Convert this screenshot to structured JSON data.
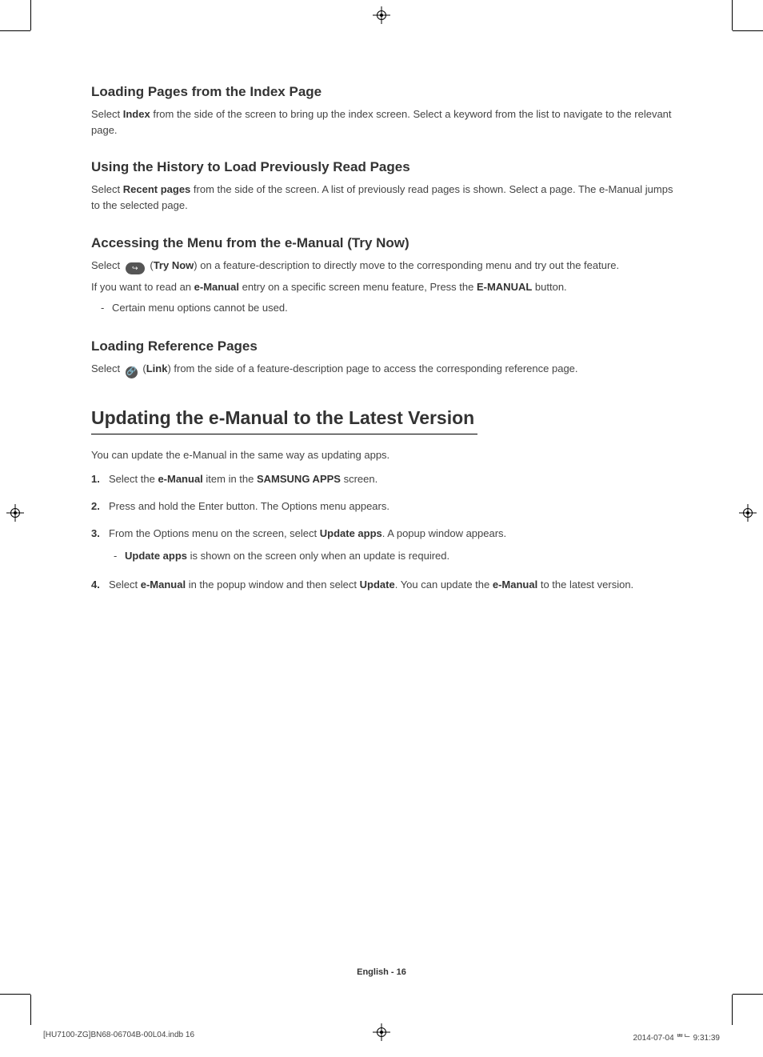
{
  "sections": {
    "index": {
      "heading": "Loading Pages from the Index Page",
      "body_pre": "Select ",
      "body_bold": "Index",
      "body_post": " from the side of the screen to bring up the index screen. Select a keyword from the list to navigate to the relevant page."
    },
    "history": {
      "heading": "Using the History to Load Previously Read Pages",
      "body_pre": "Select ",
      "body_bold": "Recent pages",
      "body_post": " from the side of the screen. A list of previously read pages is shown. Select a page. The e-Manual jumps to the selected page."
    },
    "trynow": {
      "heading": "Accessing the Menu from the e-Manual (Try Now)",
      "line1_pre": "Select ",
      "line1_label": "Try Now",
      "line1_post": ") on a feature-description to directly move to the corresponding menu and try out the feature.",
      "line2_a": "If you want to read an ",
      "line2_b": "e-Manual",
      "line2_c": " entry on a specific screen menu feature, Press the ",
      "line2_d": "E-MANUAL",
      "line2_e": " button.",
      "bullet": "Certain menu options cannot be used."
    },
    "ref": {
      "heading": "Loading Reference Pages",
      "line_pre": "Select ",
      "line_label": "Link",
      "line_post": ") from the side of a feature-description page to access the corresponding reference page."
    }
  },
  "update": {
    "heading": "Updating the e-Manual to the Latest Version",
    "intro": "You can update the e-Manual in the same way as updating apps.",
    "steps": {
      "s1_a": "Select the ",
      "s1_b": "e-Manual",
      "s1_c": " item in the ",
      "s1_d": "SAMSUNG APPS",
      "s1_e": " screen.",
      "s2": "Press and hold the Enter button. The Options menu appears.",
      "s3_a": "From the Options menu on the screen, select ",
      "s3_b": "Update apps",
      "s3_c": ". A popup window appears.",
      "s3_bullet_b": "Update apps",
      "s3_bullet_c": " is shown on the screen only when an update is required.",
      "s4_a": "Select ",
      "s4_b": "e-Manual",
      "s4_c": " in the popup window and then select ",
      "s4_d": "Update",
      "s4_e": ". You can update the ",
      "s4_f": "e-Manual",
      "s4_g": " to the latest version."
    }
  },
  "footer": {
    "page_label": "English - 16",
    "indb_file": "[HU7100-ZG]BN68-06704B-00L04.indb   16",
    "indb_time": "2014-07-04   ᄈᄂ 9:31:39"
  }
}
